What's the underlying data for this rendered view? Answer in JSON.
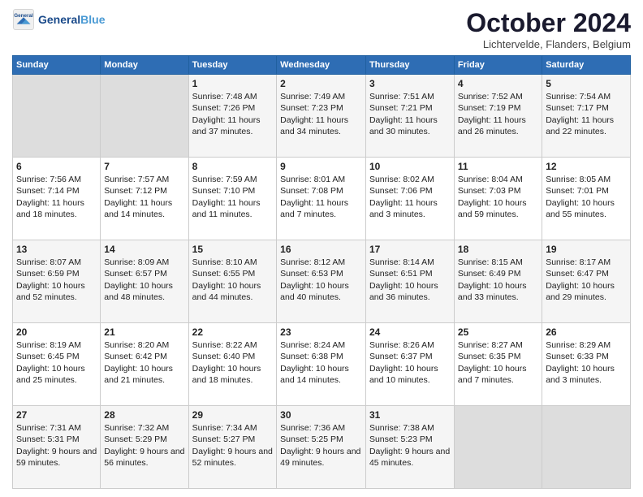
{
  "header": {
    "logo_general": "General",
    "logo_blue": "Blue",
    "month_title": "October 2024",
    "location": "Lichtervelde, Flanders, Belgium"
  },
  "days_of_week": [
    "Sunday",
    "Monday",
    "Tuesday",
    "Wednesday",
    "Thursday",
    "Friday",
    "Saturday"
  ],
  "weeks": [
    [
      {
        "day": "",
        "empty": true
      },
      {
        "day": "",
        "empty": true
      },
      {
        "day": "1",
        "sunrise": "Sunrise: 7:48 AM",
        "sunset": "Sunset: 7:26 PM",
        "daylight": "Daylight: 11 hours and 37 minutes."
      },
      {
        "day": "2",
        "sunrise": "Sunrise: 7:49 AM",
        "sunset": "Sunset: 7:23 PM",
        "daylight": "Daylight: 11 hours and 34 minutes."
      },
      {
        "day": "3",
        "sunrise": "Sunrise: 7:51 AM",
        "sunset": "Sunset: 7:21 PM",
        "daylight": "Daylight: 11 hours and 30 minutes."
      },
      {
        "day": "4",
        "sunrise": "Sunrise: 7:52 AM",
        "sunset": "Sunset: 7:19 PM",
        "daylight": "Daylight: 11 hours and 26 minutes."
      },
      {
        "day": "5",
        "sunrise": "Sunrise: 7:54 AM",
        "sunset": "Sunset: 7:17 PM",
        "daylight": "Daylight: 11 hours and 22 minutes."
      }
    ],
    [
      {
        "day": "6",
        "sunrise": "Sunrise: 7:56 AM",
        "sunset": "Sunset: 7:14 PM",
        "daylight": "Daylight: 11 hours and 18 minutes."
      },
      {
        "day": "7",
        "sunrise": "Sunrise: 7:57 AM",
        "sunset": "Sunset: 7:12 PM",
        "daylight": "Daylight: 11 hours and 14 minutes."
      },
      {
        "day": "8",
        "sunrise": "Sunrise: 7:59 AM",
        "sunset": "Sunset: 7:10 PM",
        "daylight": "Daylight: 11 hours and 11 minutes."
      },
      {
        "day": "9",
        "sunrise": "Sunrise: 8:01 AM",
        "sunset": "Sunset: 7:08 PM",
        "daylight": "Daylight: 11 hours and 7 minutes."
      },
      {
        "day": "10",
        "sunrise": "Sunrise: 8:02 AM",
        "sunset": "Sunset: 7:06 PM",
        "daylight": "Daylight: 11 hours and 3 minutes."
      },
      {
        "day": "11",
        "sunrise": "Sunrise: 8:04 AM",
        "sunset": "Sunset: 7:03 PM",
        "daylight": "Daylight: 10 hours and 59 minutes."
      },
      {
        "day": "12",
        "sunrise": "Sunrise: 8:05 AM",
        "sunset": "Sunset: 7:01 PM",
        "daylight": "Daylight: 10 hours and 55 minutes."
      }
    ],
    [
      {
        "day": "13",
        "sunrise": "Sunrise: 8:07 AM",
        "sunset": "Sunset: 6:59 PM",
        "daylight": "Daylight: 10 hours and 52 minutes."
      },
      {
        "day": "14",
        "sunrise": "Sunrise: 8:09 AM",
        "sunset": "Sunset: 6:57 PM",
        "daylight": "Daylight: 10 hours and 48 minutes."
      },
      {
        "day": "15",
        "sunrise": "Sunrise: 8:10 AM",
        "sunset": "Sunset: 6:55 PM",
        "daylight": "Daylight: 10 hours and 44 minutes."
      },
      {
        "day": "16",
        "sunrise": "Sunrise: 8:12 AM",
        "sunset": "Sunset: 6:53 PM",
        "daylight": "Daylight: 10 hours and 40 minutes."
      },
      {
        "day": "17",
        "sunrise": "Sunrise: 8:14 AM",
        "sunset": "Sunset: 6:51 PM",
        "daylight": "Daylight: 10 hours and 36 minutes."
      },
      {
        "day": "18",
        "sunrise": "Sunrise: 8:15 AM",
        "sunset": "Sunset: 6:49 PM",
        "daylight": "Daylight: 10 hours and 33 minutes."
      },
      {
        "day": "19",
        "sunrise": "Sunrise: 8:17 AM",
        "sunset": "Sunset: 6:47 PM",
        "daylight": "Daylight: 10 hours and 29 minutes."
      }
    ],
    [
      {
        "day": "20",
        "sunrise": "Sunrise: 8:19 AM",
        "sunset": "Sunset: 6:45 PM",
        "daylight": "Daylight: 10 hours and 25 minutes."
      },
      {
        "day": "21",
        "sunrise": "Sunrise: 8:20 AM",
        "sunset": "Sunset: 6:42 PM",
        "daylight": "Daylight: 10 hours and 21 minutes."
      },
      {
        "day": "22",
        "sunrise": "Sunrise: 8:22 AM",
        "sunset": "Sunset: 6:40 PM",
        "daylight": "Daylight: 10 hours and 18 minutes."
      },
      {
        "day": "23",
        "sunrise": "Sunrise: 8:24 AM",
        "sunset": "Sunset: 6:38 PM",
        "daylight": "Daylight: 10 hours and 14 minutes."
      },
      {
        "day": "24",
        "sunrise": "Sunrise: 8:26 AM",
        "sunset": "Sunset: 6:37 PM",
        "daylight": "Daylight: 10 hours and 10 minutes."
      },
      {
        "day": "25",
        "sunrise": "Sunrise: 8:27 AM",
        "sunset": "Sunset: 6:35 PM",
        "daylight": "Daylight: 10 hours and 7 minutes."
      },
      {
        "day": "26",
        "sunrise": "Sunrise: 8:29 AM",
        "sunset": "Sunset: 6:33 PM",
        "daylight": "Daylight: 10 hours and 3 minutes."
      }
    ],
    [
      {
        "day": "27",
        "sunrise": "Sunrise: 7:31 AM",
        "sunset": "Sunset: 5:31 PM",
        "daylight": "Daylight: 9 hours and 59 minutes."
      },
      {
        "day": "28",
        "sunrise": "Sunrise: 7:32 AM",
        "sunset": "Sunset: 5:29 PM",
        "daylight": "Daylight: 9 hours and 56 minutes."
      },
      {
        "day": "29",
        "sunrise": "Sunrise: 7:34 AM",
        "sunset": "Sunset: 5:27 PM",
        "daylight": "Daylight: 9 hours and 52 minutes."
      },
      {
        "day": "30",
        "sunrise": "Sunrise: 7:36 AM",
        "sunset": "Sunset: 5:25 PM",
        "daylight": "Daylight: 9 hours and 49 minutes."
      },
      {
        "day": "31",
        "sunrise": "Sunrise: 7:38 AM",
        "sunset": "Sunset: 5:23 PM",
        "daylight": "Daylight: 9 hours and 45 minutes."
      },
      {
        "day": "",
        "empty": true
      },
      {
        "day": "",
        "empty": true
      }
    ]
  ]
}
